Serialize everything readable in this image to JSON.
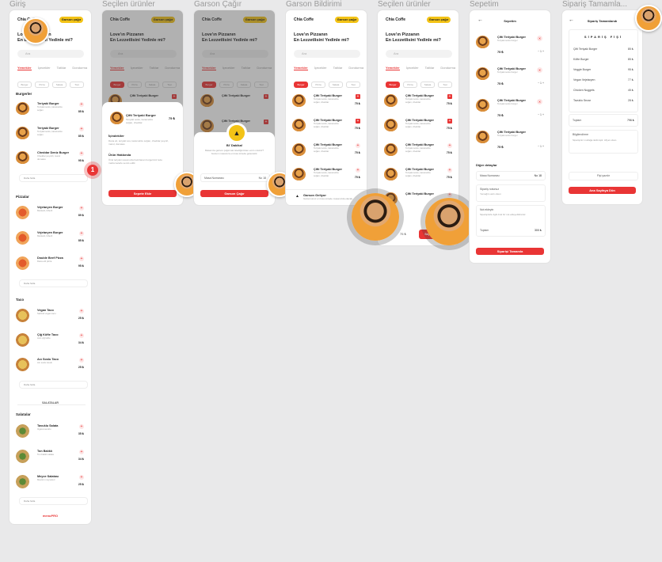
{
  "frames": [
    {
      "title": "Giriş"
    },
    {
      "title": "Seçilen ürünler"
    },
    {
      "title": "Garson Çağır"
    },
    {
      "title": "Garson Bildirimi"
    },
    {
      "title": "Seçilen ürünler"
    },
    {
      "title": "Sepetim"
    },
    {
      "title": "Sipariş Tamamla..."
    }
  ],
  "app": {
    "brand": "Chia Coffe",
    "waiter_button": "Garson çağır",
    "greeting_line1": "Love'ın Pizzanın",
    "greeting_line2": "En Lezzetlisini Yedinle mi?",
    "search_placeholder": "Ara",
    "tabs": [
      "Yemekler",
      "İçecekler",
      "Tatlılar",
      "Dondurma"
    ],
    "chips": [
      "Burger",
      "Pizza",
      "Salata",
      "Tost"
    ]
  },
  "menu": {
    "sections": [
      {
        "name": "Burgerler",
        "items": [
          {
            "name": "Teriyaki Burger",
            "desc": "Teriyaki soslu, karamelize soğan",
            "price": "85 ₺",
            "kind": "burger"
          },
          {
            "name": "Teriyaki Burger",
            "desc": "Teriyaki soslu, karamelize soğan",
            "price": "85 ₺",
            "kind": "burger"
          },
          {
            "name": "Cheddar Deniz Burger",
            "desc": "Cheddar peynirli, marul domates",
            "price": "95 ₺",
            "kind": "burger"
          }
        ],
        "more": "Daha fazla"
      },
      {
        "name": "Pizzalar",
        "items": [
          {
            "name": "Vejetaryen Burger",
            "desc": "Mantarlı, biberli",
            "price": "89 ₺",
            "kind": "pizza"
          },
          {
            "name": "Vejetaryen Burger",
            "desc": "Mantarlı, biberli",
            "price": "85 ₺",
            "kind": "pizza"
          },
          {
            "name": "Double Beef Pizza",
            "desc": "Dana etli pizza",
            "price": "95 ₺",
            "kind": "pizza"
          }
        ],
        "more": "Daha fazla"
      },
      {
        "name": "Taco",
        "items": [
          {
            "name": "Vegan Taco",
            "desc": "Sebzeli vegan taco",
            "price": "25 ₺",
            "kind": "taco"
          },
          {
            "name": "Çiğ Köfte Taco",
            "desc": "Acılı çiğ köfte",
            "price": "34 ₺",
            "kind": "taco"
          },
          {
            "name": "Acı Soslu Taco",
            "desc": "Acı soslu tavuk",
            "price": "25 ₺",
            "kind": "taco"
          }
        ],
        "more": "Daha fazla"
      },
      {
        "name": "Salatalar",
        "items": [
          {
            "name": "Tavuklu Salata",
            "desc": "Izgara tavuklu",
            "price": "35 ₺",
            "kind": "salad"
          },
          {
            "name": "Ton Balıklı",
            "desc": "Ton balıklı salata",
            "price": "34 ₺",
            "kind": "salad"
          },
          {
            "name": "Meyve Salatası",
            "desc": "Mevsim meyveleri",
            "price": "25 ₺",
            "kind": "salad"
          }
        ],
        "more": "Daha fazla"
      }
    ],
    "salad_header": "SALATALAR",
    "footer": "menuPRO"
  },
  "detail_sheet": {
    "item_name": "Çifti Teriyaki Burger",
    "item_desc": "Teriyaki soslu, karamelize soğan, cheddar",
    "item_price": "75 ₺",
    "section1_title": "İçindekiler",
    "section1_text": "Dana eti, teriyaki sos, karamelize soğan, cheddar peyniri, marul, domates",
    "section2_title": "Ürün Hakkında",
    "section2_text": "Özel teriyaki sosumuzla hazırlanan burgerimiz taze malzemelerle servis edilir.",
    "button": "Sepete Ekle"
  },
  "waiter_sheet": {
    "title": "Bi' Dakika!",
    "text": "Masanıza garson çağırmak istediğinizden emin misiniz? Garson masanıza en kısa sürede gelecektir.",
    "table_label": "Masa Numarası",
    "table_value": "No 18",
    "button": "Garson Çağır"
  },
  "notification": {
    "title": "Garson Geliyor",
    "text": "Garsonunuz en kısa sürede masanızda olacak."
  },
  "cart": {
    "title": "Sepetim",
    "items": [
      {
        "name": "Çifti Teriyaki Burger",
        "desc": "Teriyaki soslu burger",
        "price": "75 ₺",
        "qty": "1"
      },
      {
        "name": "Çifti Teriyaki Burger",
        "desc": "Teriyaki soslu burger",
        "price": "75 ₺",
        "qty": "1"
      },
      {
        "name": "Çifti Teriyaki Burger",
        "desc": "Teriyaki soslu burger",
        "price": "75 ₺",
        "qty": "1"
      },
      {
        "name": "Çifti Teriyaki Burger",
        "desc": "Teriyaki soslu burger",
        "price": "75 ₺",
        "qty": "1"
      }
    ],
    "other_title": "Diğer detaylar",
    "table_label": "Masa Numarası",
    "table_value": "No 18",
    "note_label": "Sipariş notunuz",
    "note_text": "Yemeğim acılı olsun",
    "tip_label": "Not ekleyin",
    "tip_text": "Siparişinizle ilgili özel bir not ekleyebilirsiniz.",
    "total_label": "Toplam",
    "total_value": "300 ₺",
    "button": "Siparişi Tamamla"
  },
  "receipt": {
    "title": "Sipariş Tamamlandı",
    "heading": "SİPARİŞ FİŞİ",
    "rows": [
      {
        "name": "Çifti Teriyaki Burger",
        "price": "85 ₺"
      },
      {
        "name": "Köfte Burger",
        "price": "85 ₺"
      },
      {
        "name": "Veggie Burger",
        "price": "95 ₺"
      },
      {
        "name": "Vegan Vejetaryen",
        "price": "77 ₺"
      },
      {
        "name": "Chicken Nuggets",
        "price": "45 ₺"
      },
      {
        "name": "Tavuklu Sezar",
        "price": "28 ₺"
      }
    ],
    "total_label": "Toplam",
    "total_value": "796 ₺",
    "info_title": "Bilgilendirme",
    "info_text": "Siparişiniz mutfağa iletilmiştir. Afiyet olsun.",
    "print_label": "Fişi yazdır",
    "button": "Ana Sayfaya Dön"
  },
  "colors": {
    "accent": "#e93535",
    "yellow": "#f3c316",
    "bg": "#e9e9ea"
  },
  "badge_count": "1"
}
